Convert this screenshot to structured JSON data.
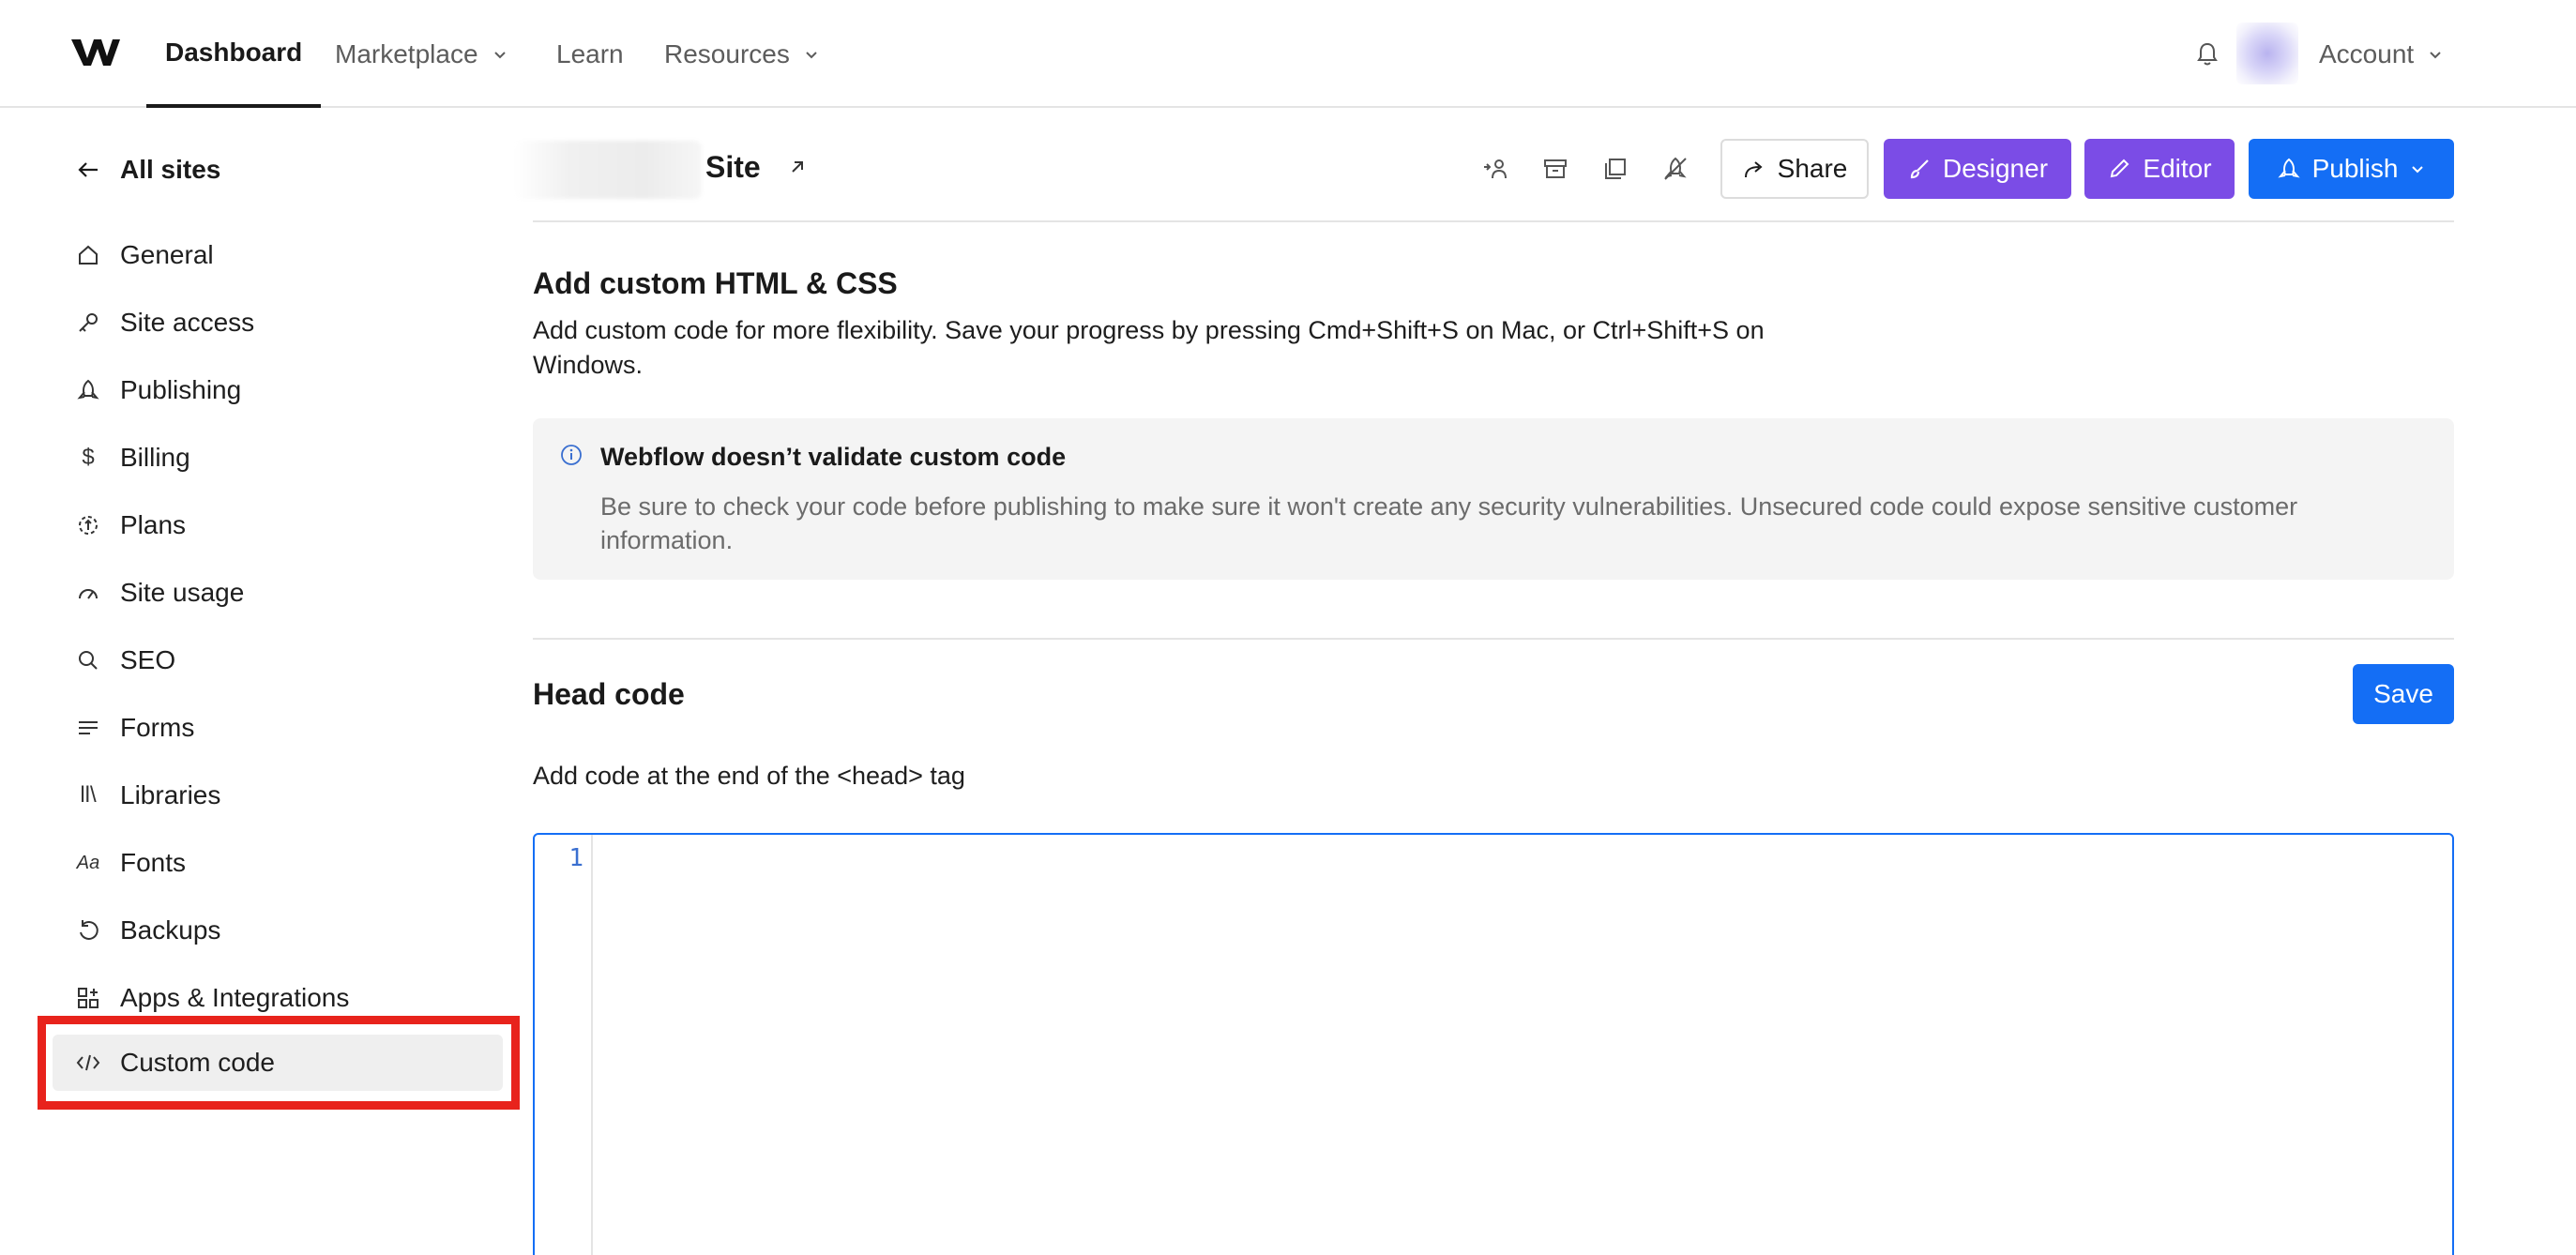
{
  "topnav": {
    "logo": "webflow-logo",
    "items": [
      {
        "label": "Dashboard",
        "active": true
      },
      {
        "label": "Marketplace",
        "has_dropdown": true
      },
      {
        "label": "Learn"
      },
      {
        "label": "Resources",
        "has_dropdown": true
      }
    ],
    "account_label": "Account"
  },
  "sidebar": {
    "back_label": "All sites",
    "items": [
      {
        "label": "General",
        "icon": "home-icon"
      },
      {
        "label": "Site access",
        "icon": "key-icon"
      },
      {
        "label": "Publishing",
        "icon": "rocket-icon"
      },
      {
        "label": "Billing",
        "icon": "dollar-icon"
      },
      {
        "label": "Plans",
        "icon": "plans-icon"
      },
      {
        "label": "Site usage",
        "icon": "gauge-icon"
      },
      {
        "label": "SEO",
        "icon": "search-icon"
      },
      {
        "label": "Forms",
        "icon": "forms-icon"
      },
      {
        "label": "Libraries",
        "icon": "libraries-icon"
      },
      {
        "label": "Fonts",
        "icon": "fonts-icon"
      },
      {
        "label": "Backups",
        "icon": "backup-icon"
      },
      {
        "label": "Apps & Integrations",
        "icon": "apps-icon"
      },
      {
        "label": "Custom code",
        "icon": "code-icon",
        "active": true
      }
    ],
    "fonts_glyph": "Aa",
    "libraries_glyph": "ll\\"
  },
  "header": {
    "site_name": "Site",
    "buttons": {
      "share": "Share",
      "designer": "Designer",
      "editor": "Editor",
      "publish": "Publish"
    }
  },
  "custom_code": {
    "title": "Add custom HTML & CSS",
    "description": "Add custom code for more flexibility. Save your progress by pressing Cmd+Shift+S on Mac, or Ctrl+Shift+S on Windows.",
    "notice": {
      "title": "Webflow doesn’t validate custom code",
      "body": "Be sure to check your code before publishing to make sure it won't create any security vulnerabilities. Unsecured code could expose sensitive customer information."
    },
    "head": {
      "title": "Head code",
      "save_label": "Save",
      "subtitle": "Add code at the end of the <head> tag",
      "line_number": "1"
    }
  },
  "colors": {
    "accent_blue": "#146ef5",
    "designer_purple": "#7b4ce6",
    "highlight_red": "#e8231c"
  }
}
